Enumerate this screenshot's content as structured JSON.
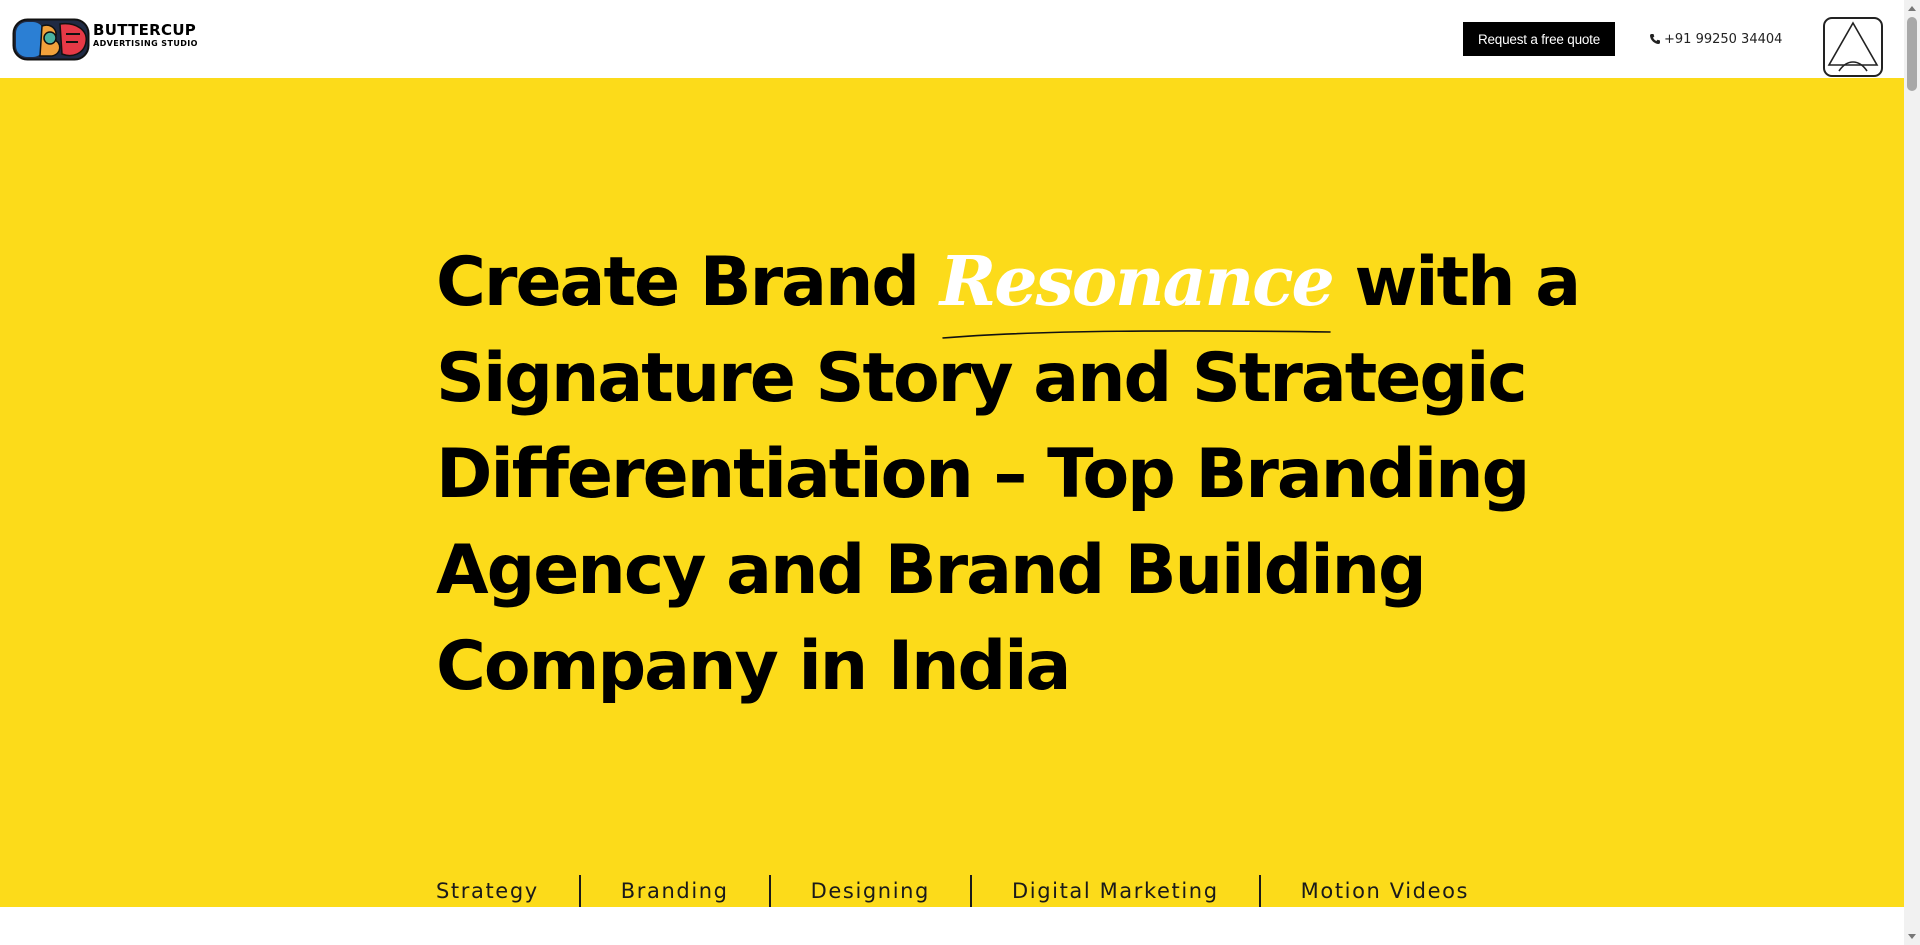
{
  "header": {
    "brand_name": "BUTTERCUP",
    "brand_subtitle": "ADVERTISING STUDIO",
    "quote_button": "Request a free quote",
    "phone": "+91 99250 34404"
  },
  "hero": {
    "headline": {
      "line1_before": "Create Brand ",
      "line1_highlight": "Resonance",
      "line1_after": " with a",
      "line2": "Signature Story and Strategic",
      "line3": "Differentiation – Top Branding",
      "line4": "Agency and Brand Building",
      "line5": "Company in India"
    },
    "services": [
      "Strategy",
      "Branding",
      "Designing",
      "Digital Marketing",
      "Motion Videos"
    ]
  },
  "icons": {
    "logo": "buttercup-logo",
    "phone": "phone-icon",
    "menu": "menu-icon"
  },
  "colors": {
    "hero_background": "#fcdb1a",
    "highlight_text": "#ffffff",
    "button_background": "#000000"
  }
}
